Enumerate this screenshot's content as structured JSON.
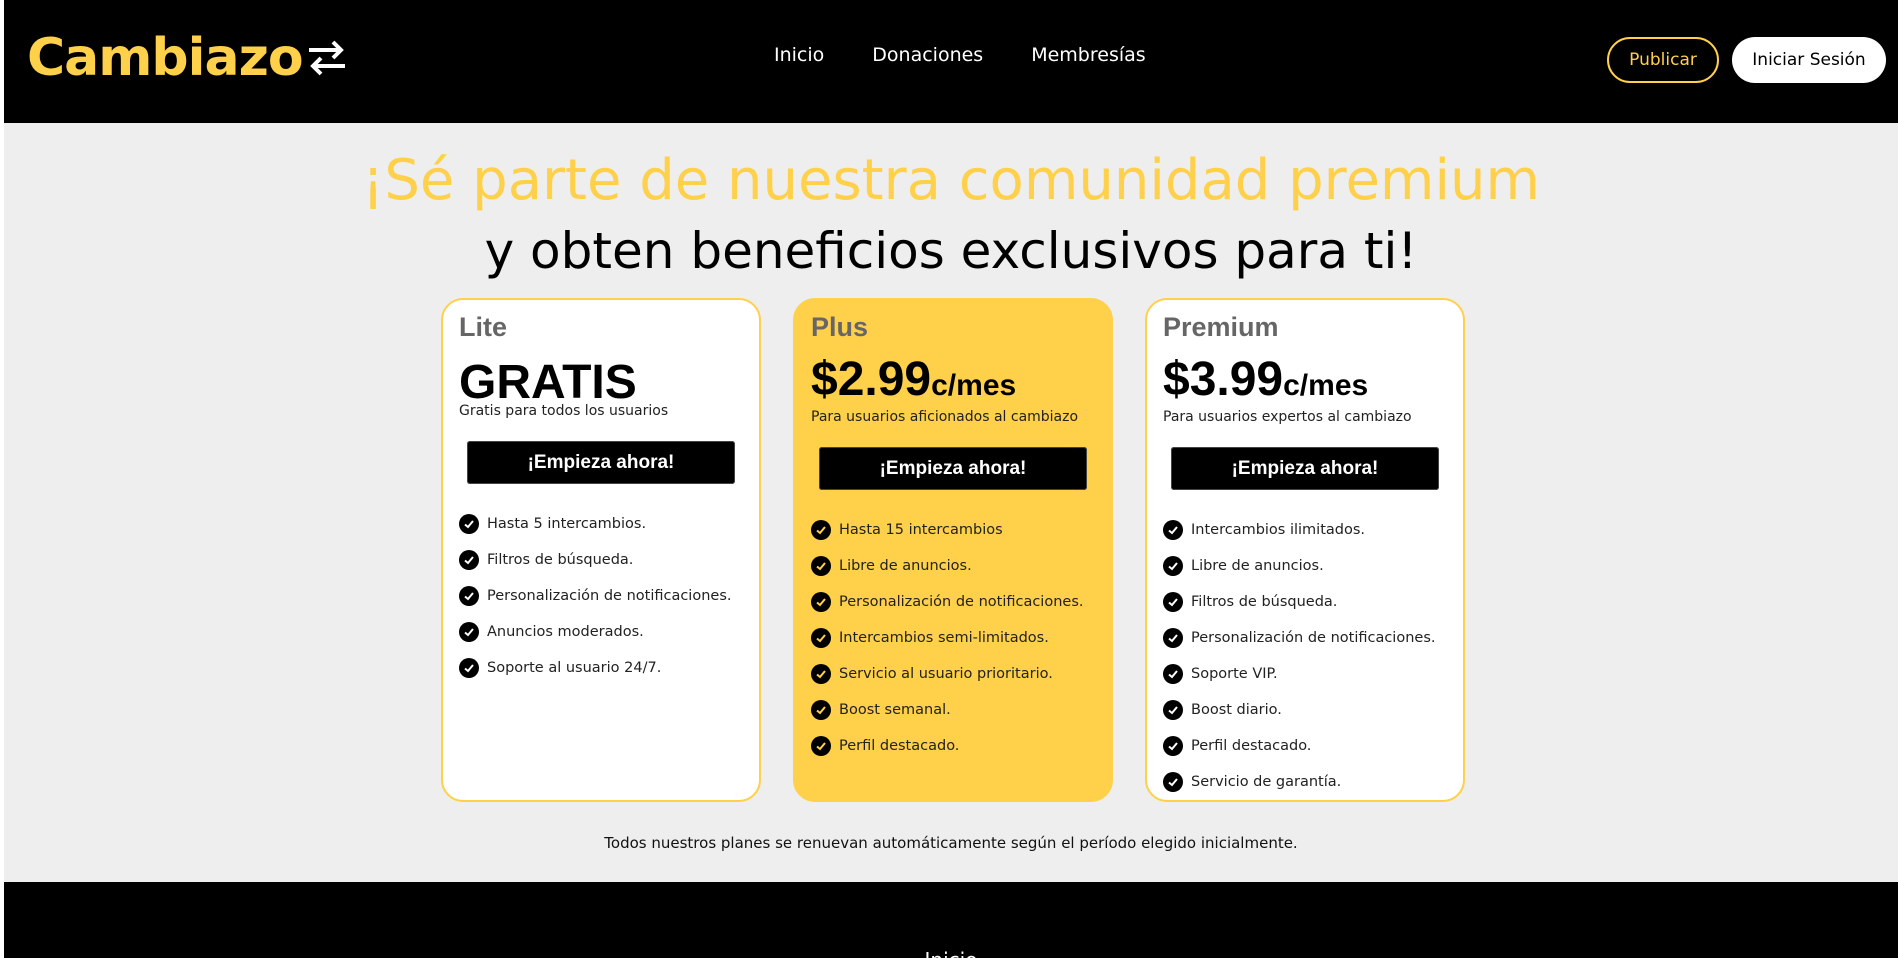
{
  "colors": {
    "brand": "#ffd04a",
    "header_bg": "#000000",
    "page_bg": "#eeeeee"
  },
  "header": {
    "logo_text": "Cambiazo",
    "logo_icon": "swap-arrows-icon",
    "nav": [
      "Inicio",
      "Donaciones",
      "Membresías"
    ],
    "publish_label": "Publicar",
    "login_label": "Iniciar Sesión"
  },
  "hero": {
    "title": "¡Sé parte de nuestra comunidad premium",
    "subtitle": "y obten beneficios exclusivos para ti!"
  },
  "plans": [
    {
      "name": "Lite",
      "price": "GRATIS",
      "unit": "",
      "description": "Gratis para todos los usuarios",
      "cta": "¡Empieza ahora!",
      "features": [
        "Hasta 5 intercambios.",
        "Filtros de búsqueda.",
        "Personalización de notificaciones.",
        "Anuncios moderados.",
        "Soporte al usuario 24/7."
      ]
    },
    {
      "name": "Plus",
      "price": "$2.99",
      "unit": "c/mes",
      "description": "Para usuarios aficionados al cambiazo",
      "cta": "¡Empieza ahora!",
      "features": [
        "Hasta 15 intercambios",
        "Libre de anuncios.",
        "Personalización de notificaciones.",
        "Intercambios semi-limitados.",
        "Servicio al usuario prioritario.",
        "Boost semanal.",
        "Perfil destacado."
      ]
    },
    {
      "name": "Premium",
      "price": "$3.99",
      "unit": "c/mes",
      "description": "Para usuarios expertos al cambiazo",
      "cta": "¡Empieza ahora!",
      "features": [
        "Intercambios ilimitados.",
        "Libre de anuncios.",
        "Filtros de búsqueda.",
        "Personalización de notificaciones.",
        "Soporte VIP.",
        "Boost diario.",
        "Perfil destacado.",
        "Servicio de garantía."
      ]
    }
  ],
  "renew_note": "Todos nuestros planes se renuevan automáticamente según el período elegido inicialmente.",
  "footer": {
    "first_link": "Inicio"
  }
}
